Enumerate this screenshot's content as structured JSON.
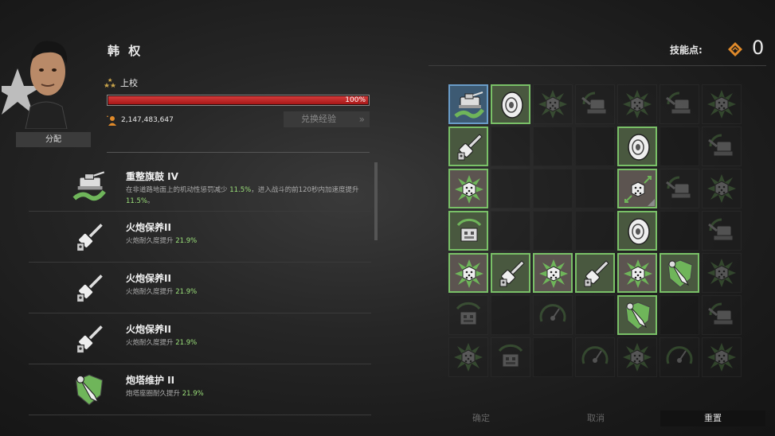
{
  "commander": {
    "name": "韩 权",
    "rank": "上校",
    "xp_percent": 100,
    "xp_text": "100%",
    "xp_value": "2,147,483,647",
    "assign_label": "分配",
    "convert_label": "兑换经验"
  },
  "skill_points": {
    "label": "技能点:",
    "value": "0"
  },
  "skills_list": [
    {
      "title": "重整旗鼓 IV",
      "desc1": "在非道路地面上的机动性惩罚减少",
      "v1": "11.5%",
      "desc2": "，进入战斗的前120秒内加速度提升",
      "v2": "11.5%",
      "desc3": "。",
      "icon": "offroad-tank-icon"
    },
    {
      "title": "火炮保养II",
      "desc1": "火炮耐久度提升",
      "v1": "21.9%",
      "icon": "cannon-icon"
    },
    {
      "title": "火炮保养II",
      "desc1": "火炮耐久度提升",
      "v1": "21.9%",
      "icon": "cannon-icon"
    },
    {
      "title": "火炮保养II",
      "desc1": "火炮耐久度提升",
      "v1": "21.9%",
      "icon": "cannon-icon"
    },
    {
      "title": "炮塔维护 II",
      "desc1": "炮塔座圈耐久提升",
      "v1": "21.9%",
      "icon": "turret-repair-icon"
    }
  ],
  "grid": [
    [
      "b:offroad",
      "g:wheel",
      "d:gear",
      "d:turret",
      "d:gear",
      "d:turret",
      "d:gear"
    ],
    [
      "g:cannon",
      "e",
      "e",
      "e",
      "g:wheel",
      "e",
      "d:turret"
    ],
    [
      "s:gear",
      "e",
      "e",
      "e",
      "s:gear2",
      "d:turret",
      "d:gear"
    ],
    [
      "g:engine",
      "e",
      "e",
      "e",
      "g:wheel",
      "e",
      "d:turret"
    ],
    [
      "s:gear",
      "g:cannon",
      "s:gear",
      "g:cannon",
      "s:gear",
      "g:repair",
      "d:gear"
    ],
    [
      "d:engine",
      "e",
      "d:gauge",
      "e",
      "g:repair",
      "e",
      "d:turret"
    ],
    [
      "d:gear",
      "d:engine",
      "e",
      "d:gauge",
      "d:gear",
      "d:gauge",
      "d:gear"
    ]
  ],
  "buttons": {
    "confirm": "确定",
    "cancel": "取消",
    "reset": "重置"
  },
  "colors": {
    "xp_bar": "#c42a2a",
    "highlight_value": "#9be07a",
    "unlocked_border": "#79c067",
    "selected_border": "#6a9cc8"
  }
}
